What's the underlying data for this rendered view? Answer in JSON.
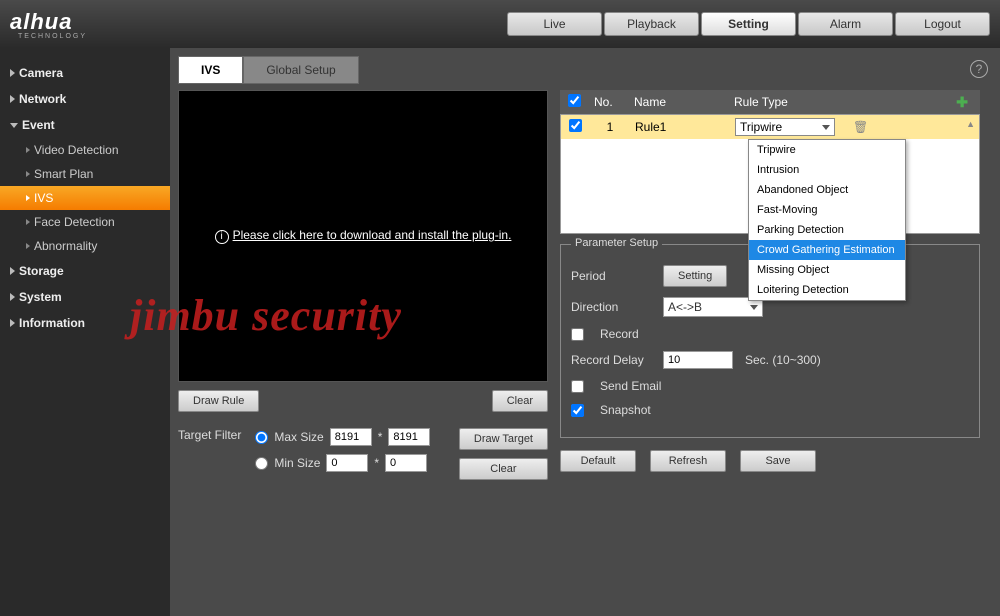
{
  "logo": {
    "main": "alhua",
    "sub": "TECHNOLOGY"
  },
  "topnav": {
    "live": "Live",
    "playback": "Playback",
    "setting": "Setting",
    "alarm": "Alarm",
    "logout": "Logout"
  },
  "sidebar": {
    "camera": "Camera",
    "network": "Network",
    "event": "Event",
    "event_subs": {
      "video_detection": "Video Detection",
      "smart_plan": "Smart Plan",
      "ivs": "IVS",
      "face_detection": "Face Detection",
      "abnormality": "Abnormality"
    },
    "storage": "Storage",
    "system": "System",
    "information": "Information"
  },
  "tabs": {
    "ivs": "IVS",
    "global": "Global Setup"
  },
  "video": {
    "msg": "Please click here to download and install the plug-in."
  },
  "buttons": {
    "draw_rule": "Draw Rule",
    "clear": "Clear",
    "draw_target": "Draw Target",
    "clear2": "Clear",
    "setting": "Setting",
    "default": "Default",
    "refresh": "Refresh",
    "save": "Save"
  },
  "target_filter": {
    "label": "Target Filter",
    "max": "Max Size",
    "min": "Min Size",
    "max_w": "8191",
    "max_h": "8191",
    "min_w": "0",
    "min_h": "0"
  },
  "rules": {
    "headers": {
      "no": "No.",
      "name": "Name",
      "type": "Rule Type"
    },
    "row1": {
      "no": "1",
      "name": "Rule1",
      "type": "Tripwire"
    },
    "dropdown": [
      "Tripwire",
      "Intrusion",
      "Abandoned Object",
      "Fast-Moving",
      "Parking Detection",
      "Crowd Gathering Estimation",
      "Missing Object",
      "Loitering Detection"
    ]
  },
  "param": {
    "title": "Parameter Setup",
    "period": "Period",
    "direction": "Direction",
    "direction_val": "A<->B",
    "record": "Record",
    "record_delay": "Record Delay",
    "record_delay_val": "10",
    "record_delay_unit": "Sec. (10~300)",
    "send_email": "Send Email",
    "snapshot": "Snapshot"
  },
  "watermark": "jimbu security"
}
